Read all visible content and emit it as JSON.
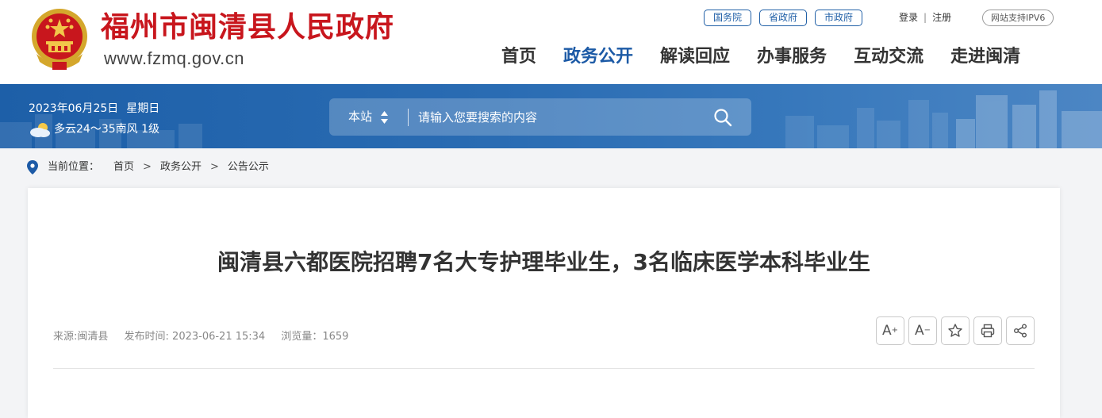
{
  "header": {
    "site_name": "福州市闽清县人民政府",
    "site_url": "www.fzmq.gov.cn",
    "gov_links": [
      "国务院",
      "省政府",
      "市政府"
    ],
    "login": "登录",
    "separator": "|",
    "register": "注册",
    "ipv6": "网站支持IPV6",
    "nav": [
      {
        "label": "首页",
        "active": false
      },
      {
        "label": "政务公开",
        "active": true
      },
      {
        "label": "解读回应",
        "active": false
      },
      {
        "label": "办事服务",
        "active": false
      },
      {
        "label": "互动交流",
        "active": false
      },
      {
        "label": "走进闽清",
        "active": false
      }
    ],
    "brand_color": "#c8161d",
    "accent_color": "#1c5aa6"
  },
  "banner": {
    "date": "2023年06月25日",
    "weekday": "星期日",
    "weather": "多云24～35南风 1级",
    "weather_icon": "partly-cloudy-icon",
    "search_scope": "本站",
    "search_placeholder": "请输入您要搜索的内容"
  },
  "breadcrumb": {
    "label": "当前位置：",
    "items": [
      "首页",
      "政务公开",
      "公告公示"
    ],
    "separator": ">"
  },
  "article": {
    "title": "闽清县六都医院招聘7名大专护理毕业生，3名临床医学本科毕业生",
    "source": "来源:闽清县",
    "published": "发布时间: 2023-06-21 15:34",
    "views": "浏览量：1659",
    "tools": {
      "font_larger": "A",
      "font_larger_mark": "+",
      "font_smaller": "A",
      "font_smaller_mark": "−"
    }
  }
}
